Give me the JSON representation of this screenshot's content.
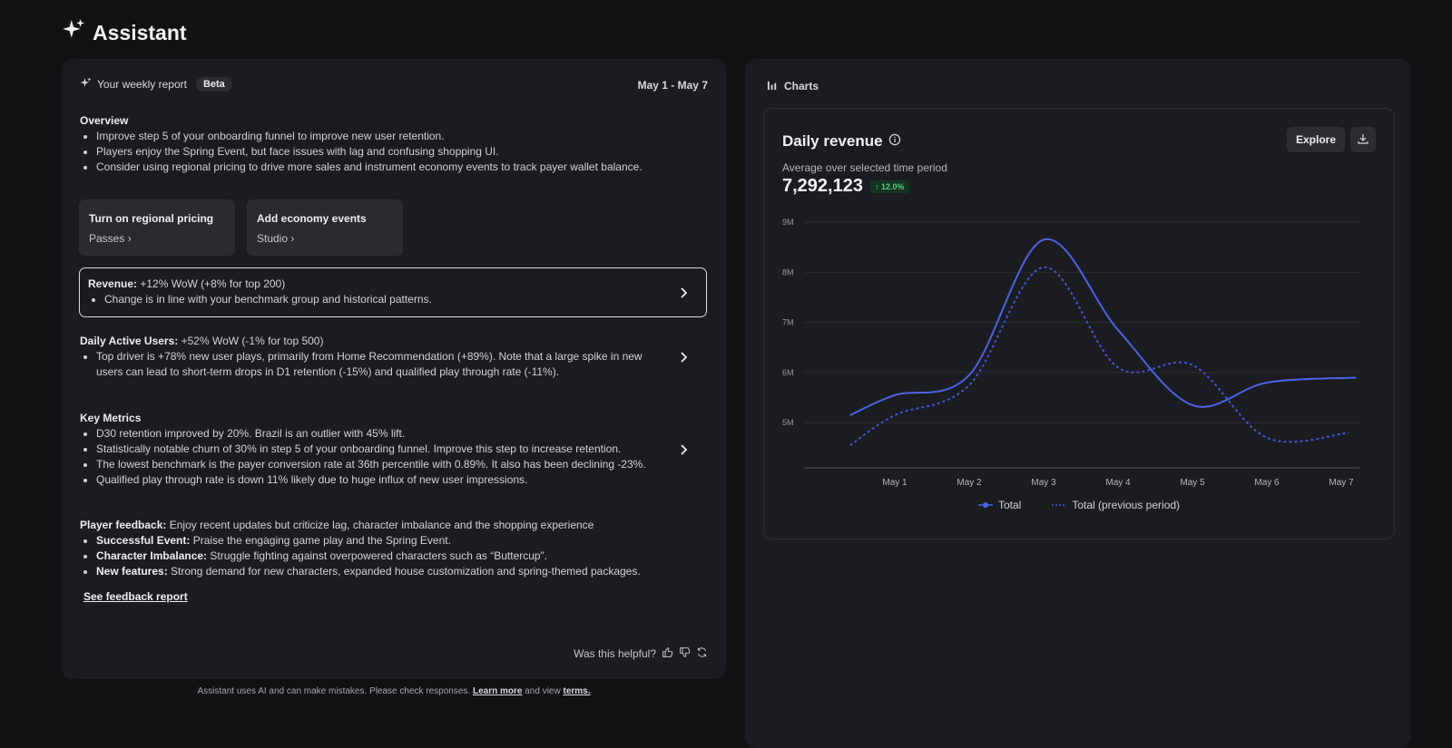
{
  "app": {
    "title": "Assistant"
  },
  "report": {
    "title": "Your weekly report",
    "badge": "Beta",
    "date_range": "May 1 - May 7",
    "overview": {
      "heading": "Overview",
      "bullets": [
        "Improve step 5 of your onboarding funnel to improve new user retention.",
        "Players enjoy the Spring Event, but face issues with lag and confusing shopping UI.",
        "Consider using regional pricing to drive more sales and instrument economy events to track payer wallet balance."
      ]
    },
    "actions": [
      {
        "title": "Turn on regional pricing",
        "sub": "Passes"
      },
      {
        "title": "Add economy events",
        "sub": "Studio"
      }
    ],
    "revenue": {
      "label": "Revenue:",
      "value": "+12% WoW (+8% for top 200)",
      "bullet": "Change is in line with your benchmark group and historical patterns."
    },
    "dau": {
      "label": "Daily Active Users:",
      "value": "+52% WoW (-1% for top 500)",
      "bullet": "Top driver is +78% new user plays, primarily from Home Recommendation (+89%). Note that a large spike in new users can lead to short-term drops in D1 retention (-15%) and qualified play through rate (-11%)."
    },
    "key_metrics": {
      "heading": "Key Metrics",
      "bullets": [
        "D30 retention improved by 20%. Brazil is an outlier with 45% lift.",
        "Statistically notable churn of 30% in step 5 of your onboarding funnel. Improve this step to increase retention.",
        "The lowest benchmark is the payer conversion rate at 36th percentile with 0.89%. It also has been declining -23%.",
        "Qualified play through rate is down 11% likely due to huge influx of new user impressions."
      ]
    },
    "feedback": {
      "label": "Player feedback:",
      "value": "Enjoy recent updates but criticize lag, character imbalance and the shopping experience",
      "items": [
        {
          "label": "Successful Event:",
          "text": "Praise the engaging game play and the Spring Event."
        },
        {
          "label": "Character Imbalance:",
          "text": "Struggle fighting against overpowered characters such as “Buttercup”."
        },
        {
          "label": "New features:",
          "text": "Strong demand for new characters, expanded house customization and spring-themed packages."
        }
      ],
      "link": "See feedback report"
    },
    "helpful": "Was this helpful?"
  },
  "footer": {
    "text": "Assistant uses AI and can make mistakes. Please check responses.",
    "learn_more": "Learn more",
    "and_view": "and view",
    "terms": "terms."
  },
  "charts": {
    "header": "Charts",
    "card": {
      "title": "Daily revenue",
      "subtitle": "Average over selected time period",
      "value": "7,292,123",
      "change": "↑ 12.0%",
      "explore": "Explore"
    }
  },
  "colors": {
    "total": "#4a63e8",
    "previous": "#3f55d6"
  },
  "chart_data": {
    "type": "line",
    "title": "Daily revenue",
    "xlabel": "",
    "ylabel": "",
    "x_ticks": [
      "May 1",
      "May 2",
      "May 3",
      "May 4",
      "May 5",
      "May 6",
      "May 7"
    ],
    "y_ticks": [
      "9M",
      "8M",
      "7M",
      "6M",
      "5M"
    ],
    "ylim": [
      4100000,
      9000000
    ],
    "grid": true,
    "legend": "bottom-center",
    "series": [
      {
        "name": "Total",
        "style": "solid",
        "x": [
          0.4,
          1.0,
          2.0,
          3.0,
          4.0,
          5.0,
          6.0,
          7.2
        ],
        "y": [
          5150000,
          5550000,
          5950000,
          8650000,
          6850000,
          5350000,
          5800000,
          5900000
        ]
      },
      {
        "name": "Total (previous period)",
        "style": "dotted",
        "x": [
          0.4,
          1.0,
          2.0,
          3.0,
          4.0,
          5.0,
          6.0,
          7.1
        ],
        "y": [
          4550000,
          5150000,
          5750000,
          8100000,
          6100000,
          6150000,
          4700000,
          4800000
        ]
      }
    ]
  }
}
